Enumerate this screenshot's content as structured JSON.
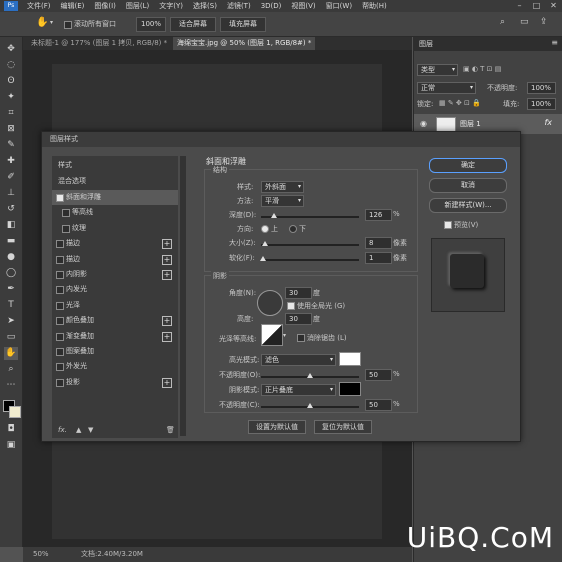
{
  "menu": [
    "文件(F)",
    "编辑(E)",
    "图像(I)",
    "图层(L)",
    "文字(Y)",
    "选择(S)",
    "滤镜(T)",
    "3D(D)",
    "视图(V)",
    "窗口(W)",
    "帮助(H)"
  ],
  "options": {
    "scroll_all": "滚动所有窗口",
    "zoom": "100%",
    "fit_screen": "适合屏幕",
    "fill_screen": "填充屏幕"
  },
  "tabs": [
    "未标题-1 @ 177% (图层 1 拷贝, RGB/8) *",
    "海绵宝宝.jpg @ 50% (图层 1, RGB/8#) *"
  ],
  "status": {
    "zoom": "50%",
    "doc": "文档:2.40M/3.20M"
  },
  "right_panel": {
    "title": "图层",
    "kind": "类型",
    "blend": "正常",
    "opacity_label": "不透明度:",
    "opacity": "100%",
    "lock_label": "锁定:",
    "fill_label": "填充:",
    "fill": "100%",
    "layer_name": "图层 1",
    "fx": "fx"
  },
  "dialog": {
    "title": "图层样式",
    "styles_header": "样式",
    "blend_options": "混合选项",
    "items": [
      {
        "label": "斜面和浮雕",
        "checked": true,
        "selected": true,
        "plus": false,
        "indent": false
      },
      {
        "label": "等高线",
        "checked": false,
        "selected": false,
        "plus": false,
        "indent": true
      },
      {
        "label": "纹理",
        "checked": false,
        "selected": false,
        "plus": false,
        "indent": true
      },
      {
        "label": "描边",
        "checked": false,
        "selected": false,
        "plus": true,
        "indent": false
      },
      {
        "label": "描边",
        "checked": false,
        "selected": false,
        "plus": true,
        "indent": false
      },
      {
        "label": "内阴影",
        "checked": false,
        "selected": false,
        "plus": true,
        "indent": false
      },
      {
        "label": "内发光",
        "checked": false,
        "selected": false,
        "plus": false,
        "indent": false
      },
      {
        "label": "光泽",
        "checked": false,
        "selected": false,
        "plus": false,
        "indent": false
      },
      {
        "label": "颜色叠加",
        "checked": false,
        "selected": false,
        "plus": true,
        "indent": false
      },
      {
        "label": "渐变叠加",
        "checked": false,
        "selected": false,
        "plus": true,
        "indent": false
      },
      {
        "label": "图案叠加",
        "checked": false,
        "selected": false,
        "plus": false,
        "indent": false
      },
      {
        "label": "外发光",
        "checked": false,
        "selected": false,
        "plus": false,
        "indent": false
      },
      {
        "label": "投影",
        "checked": false,
        "selected": false,
        "plus": true,
        "indent": false
      }
    ],
    "fx_label": "fx.",
    "section_title": "斜面和浮雕",
    "structure": {
      "title": "结构",
      "style_label": "样式:",
      "style_value": "外斜面",
      "technique_label": "方法:",
      "technique_value": "平滑",
      "depth_label": "深度(D):",
      "depth_value": "126",
      "depth_unit": "%",
      "depth_level": 0.13,
      "direction_label": "方向:",
      "dir_up": "上",
      "dir_down": "下",
      "size_label": "大小(Z):",
      "size_value": "8",
      "size_unit": "像素",
      "size_level": 0.04,
      "soften_label": "软化(F):",
      "soften_value": "1",
      "soften_unit": "像素",
      "soften_level": 0.02
    },
    "shading": {
      "title": "阴影",
      "angle_label": "角度(N):",
      "angle_value": "30",
      "angle_unit": "度",
      "global_light": "使用全局光 (G)",
      "altitude_label": "高度:",
      "altitude_value": "30",
      "altitude_unit": "度",
      "gloss_label": "光泽等高线:",
      "antialias": "消除锯齿 (L)",
      "highlight_label": "高光模式:",
      "highlight_mode": "滤色",
      "highlight_color": "#ffffff",
      "hl_opacity_label": "不透明度(O):",
      "hl_opacity": "50",
      "hl_opacity_level": 0.5,
      "shadow_label": "阴影模式:",
      "shadow_mode": "正片叠底",
      "shadow_color": "#000000",
      "sh_opacity_label": "不透明度(C):",
      "sh_opacity": "50",
      "sh_opacity_level": 0.5,
      "pct": "%"
    },
    "set_default": "设置为默认值",
    "reset_default": "复位为默认值",
    "ok": "确定",
    "cancel": "取消",
    "new_style": "新建样式(W)...",
    "preview": "预览(V)"
  },
  "watermark": "UiBQ.CoM"
}
